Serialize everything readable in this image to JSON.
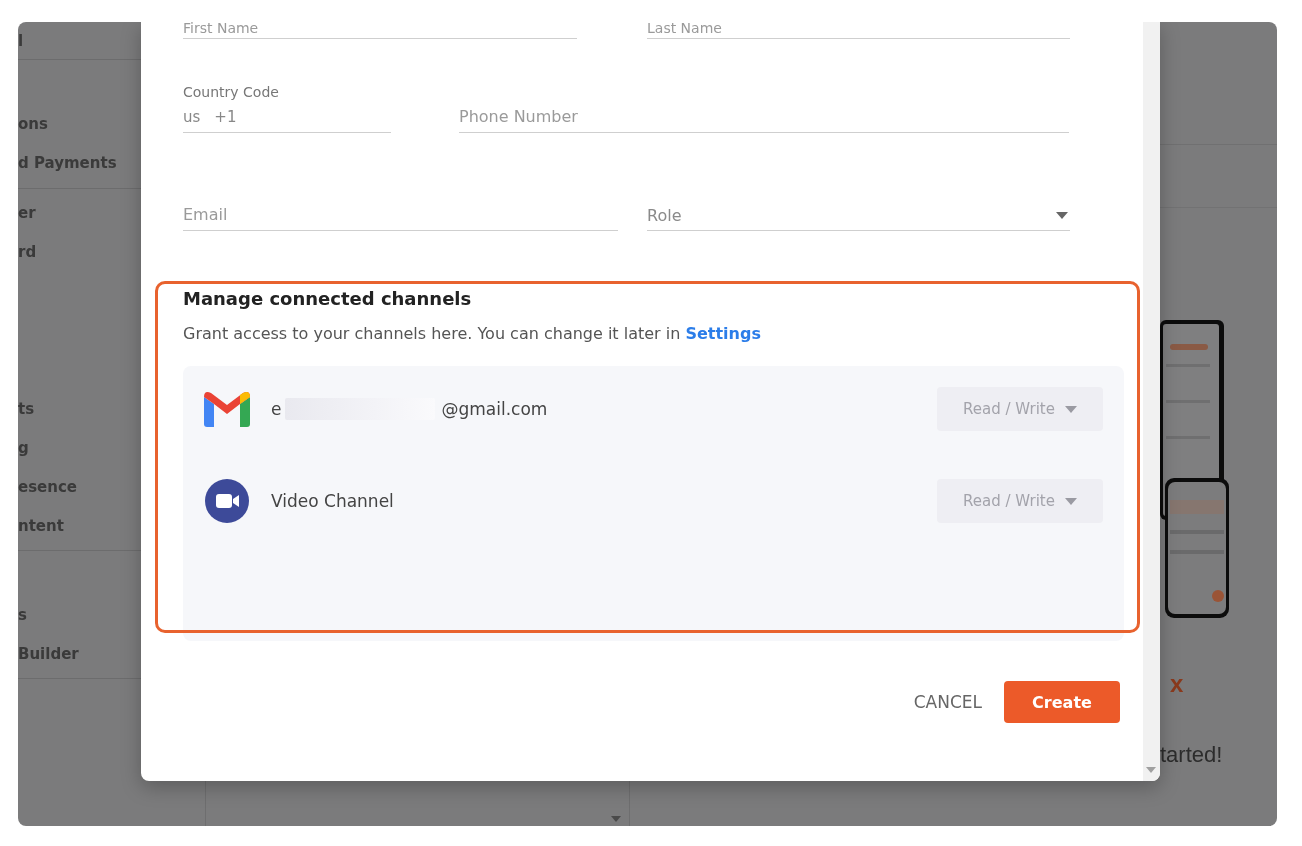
{
  "sidebar": {
    "groups": [
      {
        "items": [
          "l"
        ],
        "divider": true
      },
      {
        "items": [
          "ons",
          "d Payments"
        ],
        "divider": true
      },
      {
        "items": [
          "er",
          "rd"
        ],
        "divider": false
      },
      {
        "items": [
          "ts",
          "g",
          "esence",
          "ntent"
        ],
        "divider": true
      },
      {
        "items": [
          "s",
          "Builder"
        ],
        "divider": true
      }
    ]
  },
  "background": {
    "brand_fragment": "x",
    "tagline_fragment": "tarted!"
  },
  "form": {
    "first_name": {
      "placeholder": "First Name"
    },
    "last_name": {
      "placeholder": "Last Name"
    },
    "country_code": {
      "label": "Country Code",
      "country": "us",
      "code": "+1"
    },
    "phone": {
      "placeholder": "Phone Number"
    },
    "email": {
      "placeholder": "Email"
    },
    "role": {
      "placeholder": "Role"
    }
  },
  "channels_section": {
    "title": "Manage connected channels",
    "description": "Grant access to your channels here. You can change it later in",
    "link": "Settings"
  },
  "channels": [
    {
      "kind": "gmail",
      "name_start": "e",
      "name_end": "@gmail.com",
      "access": "Read / Write"
    },
    {
      "kind": "video",
      "name_start": "Video Channel",
      "access": "Read / Write"
    }
  ],
  "buttons": {
    "cancel": "CANCEL",
    "create": "Create"
  }
}
